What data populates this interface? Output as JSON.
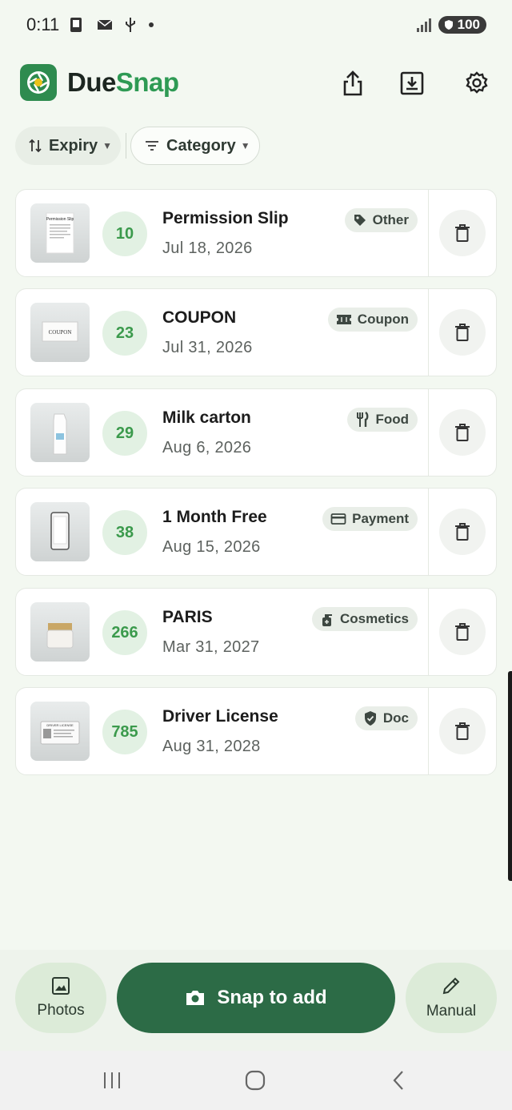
{
  "status_bar": {
    "time": "0:11",
    "battery": "100"
  },
  "header": {
    "app_name_part1": "Due",
    "app_name_part2": "Snap",
    "icons": [
      "share-icon",
      "download-icon",
      "settings-icon"
    ]
  },
  "filters": {
    "sort_label": "Expiry",
    "category_label": "Category"
  },
  "items": [
    {
      "days": "10",
      "title": "Permission Slip",
      "date": "Jul 18, 2026",
      "category": "Other",
      "category_icon": "tag-icon",
      "thumb_text": "Permission Slip"
    },
    {
      "days": "23",
      "title": "COUPON",
      "date": "Jul 31, 2026",
      "category": "Coupon",
      "category_icon": "ticket-icon",
      "thumb_text": "COUPON"
    },
    {
      "days": "29",
      "title": "Milk carton",
      "date": "Aug 6, 2026",
      "category": "Food",
      "category_icon": "utensils-icon",
      "thumb_text": ""
    },
    {
      "days": "38",
      "title": "1 Month Free",
      "date": "Aug 15, 2026",
      "category": "Payment",
      "category_icon": "credit-card-icon",
      "thumb_text": ""
    },
    {
      "days": "266",
      "title": "PARIS",
      "date": "Mar 31, 2027",
      "category": "Cosmetics",
      "category_icon": "spray-bottle-icon",
      "thumb_text": ""
    },
    {
      "days": "785",
      "title": "Driver License",
      "date": "Aug 31, 2028",
      "category": "Doc",
      "category_icon": "shield-check-icon",
      "thumb_text": "DRIVER LICENSE"
    }
  ],
  "bottom_bar": {
    "photos_label": "Photos",
    "snap_label": "Snap to add",
    "manual_label": "Manual"
  },
  "colors": {
    "accent": "#2c6b46",
    "brand_green": "#2e9a54",
    "days_text": "#3b9a4c",
    "days_bg": "#e2f1e3",
    "background": "#f3f8f1"
  }
}
